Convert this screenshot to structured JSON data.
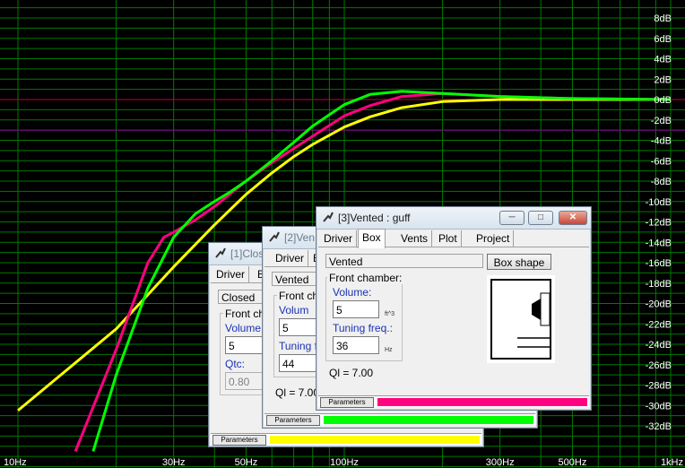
{
  "chart_data": {
    "type": "line",
    "xscale": "log",
    "xlim": [
      10,
      1000
    ],
    "ylim": [
      -34,
      10
    ],
    "x_ticks": [
      "10Hz",
      "30Hz",
      "50Hz",
      "100Hz",
      "300Hz",
      "500Hz",
      "1kHz"
    ],
    "x_tick_values": [
      10,
      30,
      50,
      100,
      300,
      500,
      1000
    ],
    "y_ticks": [
      "8dB",
      "6dB",
      "4dB",
      "2dB",
      "0dB",
      "-2dB",
      "-4dB",
      "-6dB",
      "-8dB",
      "-10dB",
      "-12dB",
      "-14dB",
      "-16dB",
      "-18dB",
      "-20dB",
      "-22dB",
      "-24dB",
      "-26dB",
      "-28dB",
      "-30dB",
      "-32dB"
    ],
    "y_tick_values": [
      8,
      6,
      4,
      2,
      0,
      -2,
      -4,
      -6,
      -8,
      -10,
      -12,
      -14,
      -16,
      -18,
      -20,
      -22,
      -24,
      -26,
      -28,
      -30,
      -32
    ],
    "grid": true,
    "reference_lines": [
      {
        "y": 0,
        "color": "#c00040"
      },
      {
        "y": -3,
        "color": "#9000a0"
      }
    ],
    "series": [
      {
        "color": "#ffff00",
        "x": [
          10,
          20,
          30,
          40,
          50,
          60,
          70,
          80,
          100,
          120,
          150,
          200,
          300,
          500,
          1000
        ],
        "y": [
          -30.5,
          -22.5,
          -16.4,
          -12.3,
          -9.3,
          -7.2,
          -5.6,
          -4.4,
          -2.7,
          -1.7,
          -0.8,
          -0.2,
          0,
          0,
          0
        ]
      },
      {
        "color": "#ff0080",
        "x": [
          15,
          20,
          25,
          28,
          30,
          35,
          40,
          50,
          60,
          70,
          80,
          100,
          120,
          150,
          200,
          300,
          500,
          1000
        ],
        "y": [
          -34.5,
          -24.5,
          -16,
          -13.5,
          -13,
          -11.8,
          -10.5,
          -8,
          -6.2,
          -4.8,
          -3.6,
          -1.6,
          -0.6,
          0.3,
          0.6,
          0.3,
          0.1,
          0
        ]
      },
      {
        "color": "#00ff00",
        "x": [
          17,
          20,
          25,
          30,
          35,
          40,
          45,
          50,
          60,
          70,
          80,
          100,
          120,
          150,
          200,
          300,
          500,
          1000
        ],
        "y": [
          -34.5,
          -27,
          -18.5,
          -13.5,
          -11.2,
          -10,
          -9,
          -8,
          -6,
          -4.2,
          -2.6,
          -0.5,
          0.5,
          0.8,
          0.6,
          0.3,
          0.1,
          0
        ]
      }
    ]
  },
  "windows": {
    "w1": {
      "title": "[1]Clos",
      "tabs": [
        "Driver",
        "B"
      ],
      "type_value": "Closed",
      "group_label": "Front cha",
      "volume_label": "Volume:",
      "volume_value": "5",
      "qtc_label": "Qtc:",
      "qtc_value": "0.80",
      "status_label": "Parameters",
      "bar_color": "#ffff00"
    },
    "w2": {
      "title": "[2]Ven",
      "tabs": [
        "Driver",
        "B"
      ],
      "type_value": "Vented",
      "group_label": "Front cha",
      "volume_label": "Volum",
      "volume_value": "5",
      "tuning_label": "Tuning fr",
      "tuning_value": "44",
      "ql": "Ql = 7.00",
      "status_label": "Parameters",
      "bar_color": "#00ff00"
    },
    "w3": {
      "title": "[3]Vented : guff",
      "tabs": [
        "Driver",
        "Box",
        "Vents",
        "Plot",
        "Project"
      ],
      "type_value": "Vented",
      "box_shape_button": "Box shape",
      "group_label": "Front chamber:",
      "volume_label": "Volume:",
      "volume_value": "5",
      "volume_unit": "ft^3",
      "tuning_label": "Tuning freq.:",
      "tuning_value": "36",
      "tuning_unit": "Hz",
      "ql": "Ql = 7.00",
      "status_label": "Parameters",
      "bar_color": "#ff0080",
      "minimize_icon": "minimize-icon",
      "maximize_icon": "maximize-icon",
      "close_icon": "close-icon"
    }
  }
}
